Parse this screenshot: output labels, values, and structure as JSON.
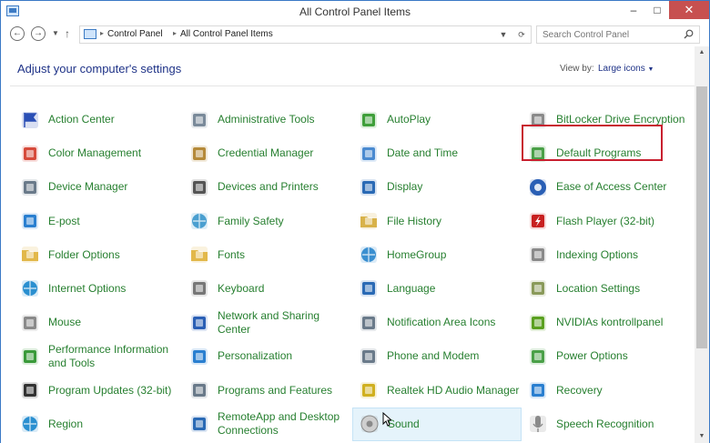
{
  "window": {
    "title": "All Control Panel Items",
    "controls": {
      "minimize": "–",
      "maximize": "□",
      "close": "✕"
    }
  },
  "nav": {
    "back_icon": "back-arrow-icon",
    "forward_icon": "forward-arrow-icon",
    "breadcrumb": [
      "Control Panel",
      "All Control Panel Items"
    ],
    "search_placeholder": "Search Control Panel"
  },
  "content": {
    "heading": "Adjust your computer's settings",
    "view_by_label": "View by:",
    "view_by_value": "Large icons"
  },
  "items": [
    {
      "label": "Action Center",
      "icon": "flag-icon",
      "color": "#2a4fb5"
    },
    {
      "label": "Administrative Tools",
      "icon": "gear-tools-icon",
      "color": "#7a8a9a"
    },
    {
      "label": "AutoPlay",
      "icon": "autoplay-icon",
      "color": "#3f9f3a"
    },
    {
      "label": "BitLocker Drive Encryption",
      "icon": "bitlocker-icon",
      "color": "#8a8a8a"
    },
    {
      "label": "Color Management",
      "icon": "color-management-icon",
      "color": "#d64a3b"
    },
    {
      "label": "Credential Manager",
      "icon": "credential-icon",
      "color": "#b58a3a"
    },
    {
      "label": "Date and Time",
      "icon": "calendar-clock-icon",
      "color": "#4a8ad0"
    },
    {
      "label": "Default Programs",
      "icon": "default-programs-icon",
      "color": "#4aa048"
    },
    {
      "label": "Device Manager",
      "icon": "device-manager-icon",
      "color": "#6a7a8a"
    },
    {
      "label": "Devices and Printers",
      "icon": "printer-icon",
      "color": "#555555"
    },
    {
      "label": "Display",
      "icon": "monitor-icon",
      "color": "#2a6ab5"
    },
    {
      "label": "Ease of Access Center",
      "icon": "ease-of-access-icon",
      "color": "#2a5fb5"
    },
    {
      "label": "E-post",
      "icon": "mail-icon",
      "color": "#2a7fd0"
    },
    {
      "label": "Family Safety",
      "icon": "family-icon",
      "color": "#4a9fd0"
    },
    {
      "label": "File History",
      "icon": "file-history-icon",
      "color": "#d8b24a"
    },
    {
      "label": "Flash Player (32-bit)",
      "icon": "flash-icon",
      "color": "#c82020"
    },
    {
      "label": "Folder Options",
      "icon": "folder-icon",
      "color": "#e2b84a"
    },
    {
      "label": "Fonts",
      "icon": "fonts-icon",
      "color": "#e2b84a"
    },
    {
      "label": "HomeGroup",
      "icon": "homegroup-icon",
      "color": "#3a8fd0"
    },
    {
      "label": "Indexing Options",
      "icon": "indexing-icon",
      "color": "#8a8a8a"
    },
    {
      "label": "Internet Options",
      "icon": "globe-icon",
      "color": "#2a8fd0"
    },
    {
      "label": "Keyboard",
      "icon": "keyboard-icon",
      "color": "#777777"
    },
    {
      "label": "Language",
      "icon": "language-icon",
      "color": "#2a6ab5"
    },
    {
      "label": "Location Settings",
      "icon": "location-icon",
      "color": "#8a9a5a"
    },
    {
      "label": "Mouse",
      "icon": "mouse-icon",
      "color": "#8a8a8a"
    },
    {
      "label": "Network and Sharing Center",
      "icon": "network-icon",
      "color": "#2a5fb5"
    },
    {
      "label": "Notification Area Icons",
      "icon": "notification-icon",
      "color": "#6a7a8a"
    },
    {
      "label": "NVIDIAs kontrollpanel",
      "icon": "nvidia-icon",
      "color": "#5aa020"
    },
    {
      "label": "Performance Information and Tools",
      "icon": "performance-icon",
      "color": "#3a9a3a"
    },
    {
      "label": "Personalization",
      "icon": "personalization-icon",
      "color": "#2a7fd0"
    },
    {
      "label": "Phone and Modem",
      "icon": "phone-icon",
      "color": "#6a7a8a"
    },
    {
      "label": "Power Options",
      "icon": "power-icon",
      "color": "#4aa048"
    },
    {
      "label": "Program Updates (32-bit)",
      "icon": "program-updates-icon",
      "color": "#333333"
    },
    {
      "label": "Programs and Features",
      "icon": "programs-icon",
      "color": "#6a7a8a"
    },
    {
      "label": "Realtek HD Audio Manager",
      "icon": "realtek-icon",
      "color": "#d0b020"
    },
    {
      "label": "Recovery",
      "icon": "recovery-icon",
      "color": "#2a7fd0"
    },
    {
      "label": "Region",
      "icon": "region-icon",
      "color": "#2a8fd0"
    },
    {
      "label": "RemoteApp and Desktop Connections",
      "icon": "remoteapp-icon",
      "color": "#2a6ab5"
    },
    {
      "label": "Sound",
      "icon": "speaker-icon",
      "color": "#8a8a8a"
    },
    {
      "label": "Speech Recognition",
      "icon": "microphone-icon",
      "color": "#8a8a8a"
    }
  ],
  "state": {
    "hovered_item": "Sound",
    "highlighted_item": "Ease of Access Center"
  }
}
